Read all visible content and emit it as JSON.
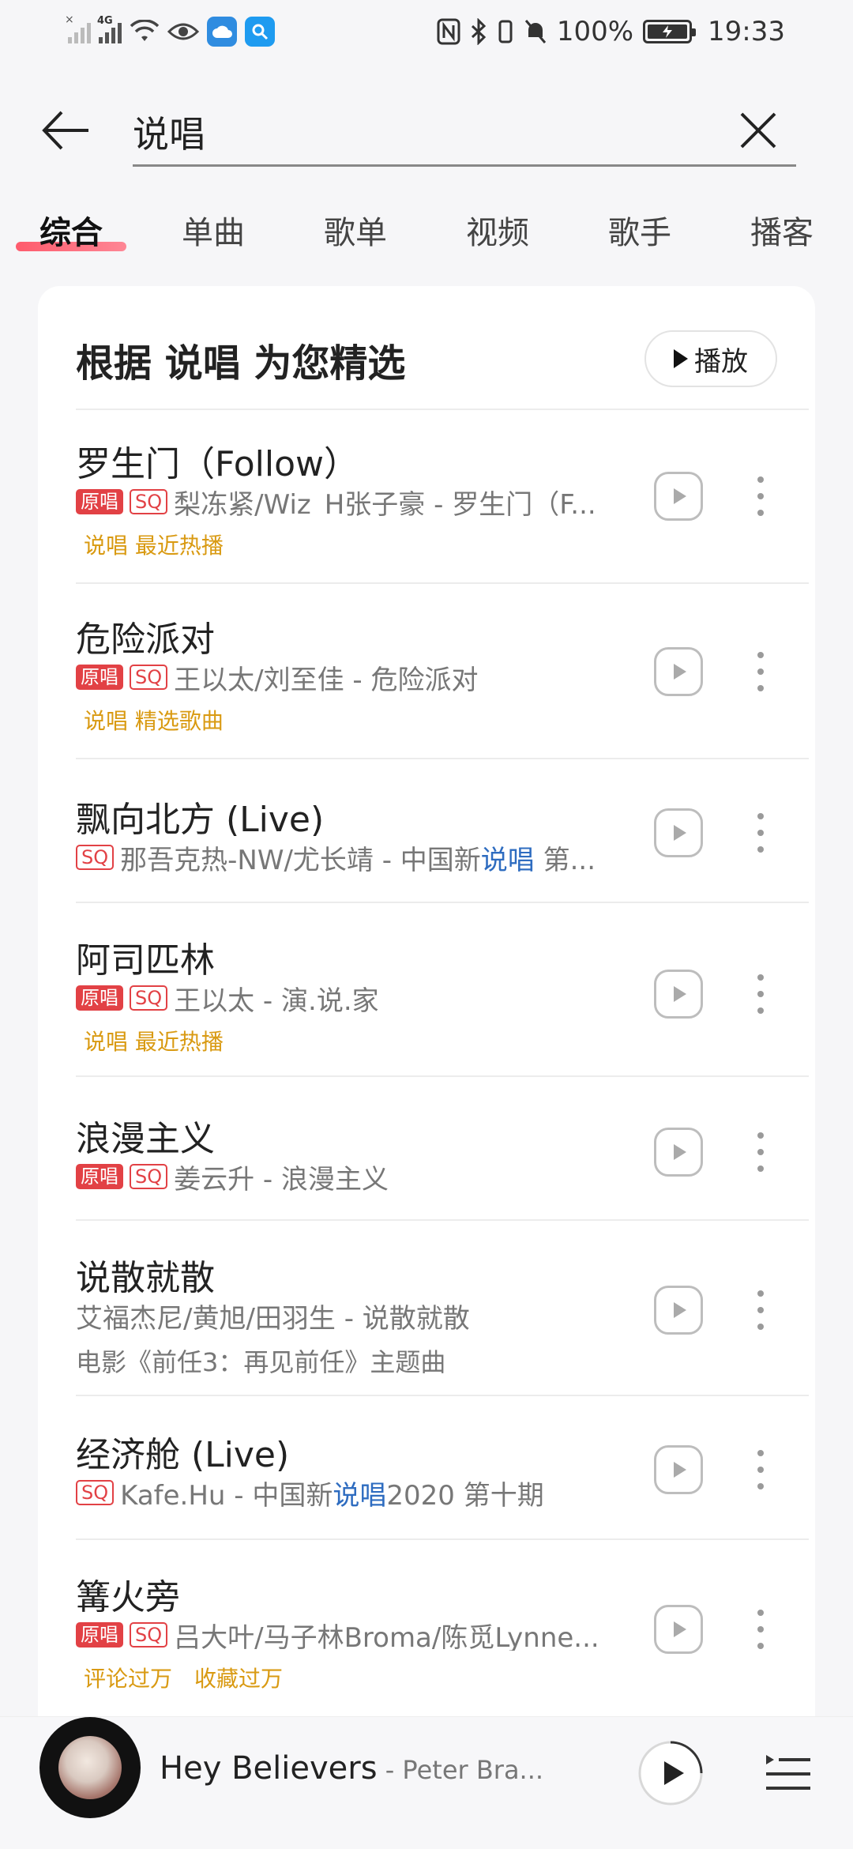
{
  "status_bar": {
    "net_tag": "4G",
    "battery": "100%",
    "time": "19:33"
  },
  "search": {
    "query": "说唱"
  },
  "tabs": [
    "综合",
    "单曲",
    "歌单",
    "视频",
    "歌手",
    "播客"
  ],
  "active_tab": "综合",
  "section": {
    "title": "根据 说唱 为您精选",
    "play_all": "播放"
  },
  "songs": [
    {
      "title": "罗生门（Follow）",
      "badge_original": "原唱",
      "badge_sq": "SQ",
      "meta": "梨冻紧/Wiz_H张子豪 - 罗生门（F...",
      "tags": [
        "说唱 最近热播"
      ]
    },
    {
      "title": "危险派对",
      "badge_original": "原唱",
      "badge_sq": "SQ",
      "meta": "王以太/刘至佳 - 危险派对",
      "tags": [
        "说唱 精选歌曲"
      ]
    },
    {
      "title": "飘向北方 (Live)",
      "badge_sq": "SQ",
      "meta_pre": "那吾克热-NW/尤长靖 - 中国新",
      "meta_hl": "说唱",
      "meta_post": " 第..."
    },
    {
      "title": "阿司匹林",
      "badge_original": "原唱",
      "badge_sq": "SQ",
      "meta": "王以太 - 演.说.家",
      "tags": [
        "说唱 最近热播"
      ]
    },
    {
      "title": "浪漫主义",
      "badge_original": "原唱",
      "badge_sq": "SQ",
      "meta": "姜云升 - 浪漫主义"
    },
    {
      "title": "说散就散",
      "meta": "艾福杰尼/黄旭/田羽生 - 说散就散",
      "desc": "电影《前任3：再见前任》主题曲"
    },
    {
      "title": "经济舱 (Live)",
      "badge_sq": "SQ",
      "meta_pre": "Kafe.Hu - 中国新",
      "meta_hl": "说唱",
      "meta_post": "2020 第十期"
    },
    {
      "title": "篝火旁",
      "badge_original": "原唱",
      "badge_sq": "SQ",
      "meta": "吕大叶/马子林Broma/陈觅Lynne...",
      "tags": [
        "评论过万",
        "收藏过万"
      ]
    }
  ],
  "now_playing": {
    "title": "Hey Believers",
    "artist": " - Peter Bra..."
  },
  "colors": {
    "accent_red": "#e24145",
    "tag_gold": "#d99a12",
    "highlight_blue": "#2e6cc0"
  },
  "icons": [
    "back-arrow-icon",
    "close-icon",
    "play-icon",
    "more-vert-icon",
    "queue-icon"
  ]
}
